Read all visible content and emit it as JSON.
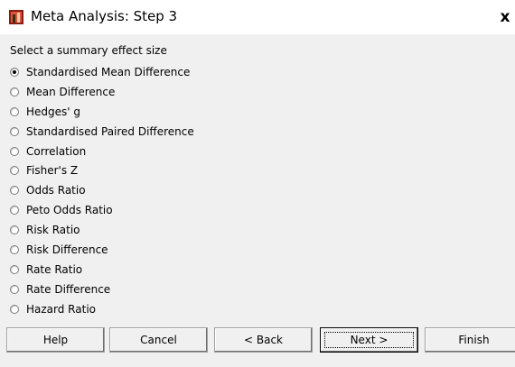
{
  "window": {
    "title": "Meta Analysis: Step 3",
    "icon": "app-icon",
    "close_label": "x"
  },
  "prompt": "Select a summary effect size",
  "options": [
    {
      "label": "Standardised Mean Difference",
      "checked": true
    },
    {
      "label": "Mean Difference",
      "checked": false
    },
    {
      "label": "Hedges' g",
      "checked": false
    },
    {
      "label": "Standardised Paired Difference",
      "checked": false
    },
    {
      "label": "Correlation",
      "checked": false
    },
    {
      "label": "Fisher's Z",
      "checked": false
    },
    {
      "label": "Odds Ratio",
      "checked": false
    },
    {
      "label": "Peto Odds Ratio",
      "checked": false
    },
    {
      "label": "Risk Ratio",
      "checked": false
    },
    {
      "label": "Risk Difference",
      "checked": false
    },
    {
      "label": "Rate Ratio",
      "checked": false
    },
    {
      "label": "Rate Difference",
      "checked": false
    },
    {
      "label": "Hazard Ratio",
      "checked": false
    }
  ],
  "buttons": {
    "help": "Help",
    "cancel": "Cancel",
    "back": "< Back",
    "next": "Next >",
    "finish": "Finish"
  }
}
